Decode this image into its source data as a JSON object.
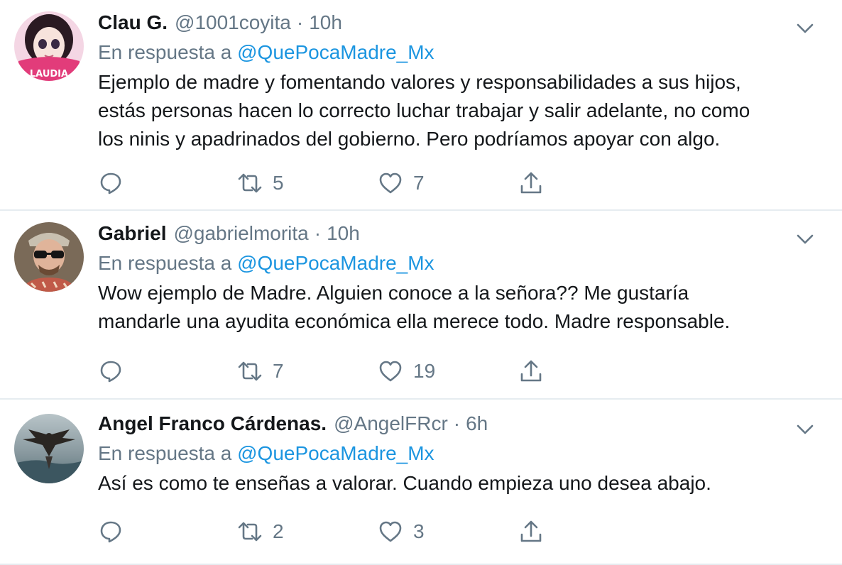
{
  "reply_prefix": "En respuesta a",
  "tweets": [
    {
      "name": "Clau G.",
      "handle": "@1001coyita",
      "time": "10h",
      "reply_to": "@QuePocaMadre_Mx",
      "avatar_label": "LAUDIA",
      "text_lines": [
        "Ejemplo de madre y fomentando valores y responsabilidades a sus hijos,",
        "estás personas hacen lo correcto luchar trabajar y salir adelante, no como",
        "los ninis y apadrinados del gobierno. Pero podríamos apoyar con algo."
      ],
      "retweets": "5",
      "likes": "7"
    },
    {
      "name": "Gabriel",
      "handle": "@gabrielmorita",
      "time": "10h",
      "reply_to": "@QuePocaMadre_Mx",
      "text_lines": [
        "Wow ejemplo de Madre. Alguien conoce a la señora?? Me gustaría",
        "mandarle una ayudita económica ella merece todo. Madre responsable."
      ],
      "retweets": "7",
      "likes": "19"
    },
    {
      "name": "Angel Franco Cárdenas.",
      "handle": "@AngelFRcr",
      "time": "6h",
      "reply_to": "@QuePocaMadre_Mx",
      "text_lines": [
        "Así es como te enseñas a valorar. Cuando empieza uno desea abajo."
      ],
      "retweets": "2",
      "likes": "3"
    }
  ],
  "colors": {
    "text": "#14171a",
    "secondary": "#657786",
    "link": "#1b95e0",
    "divider": "#e6ecf0"
  }
}
